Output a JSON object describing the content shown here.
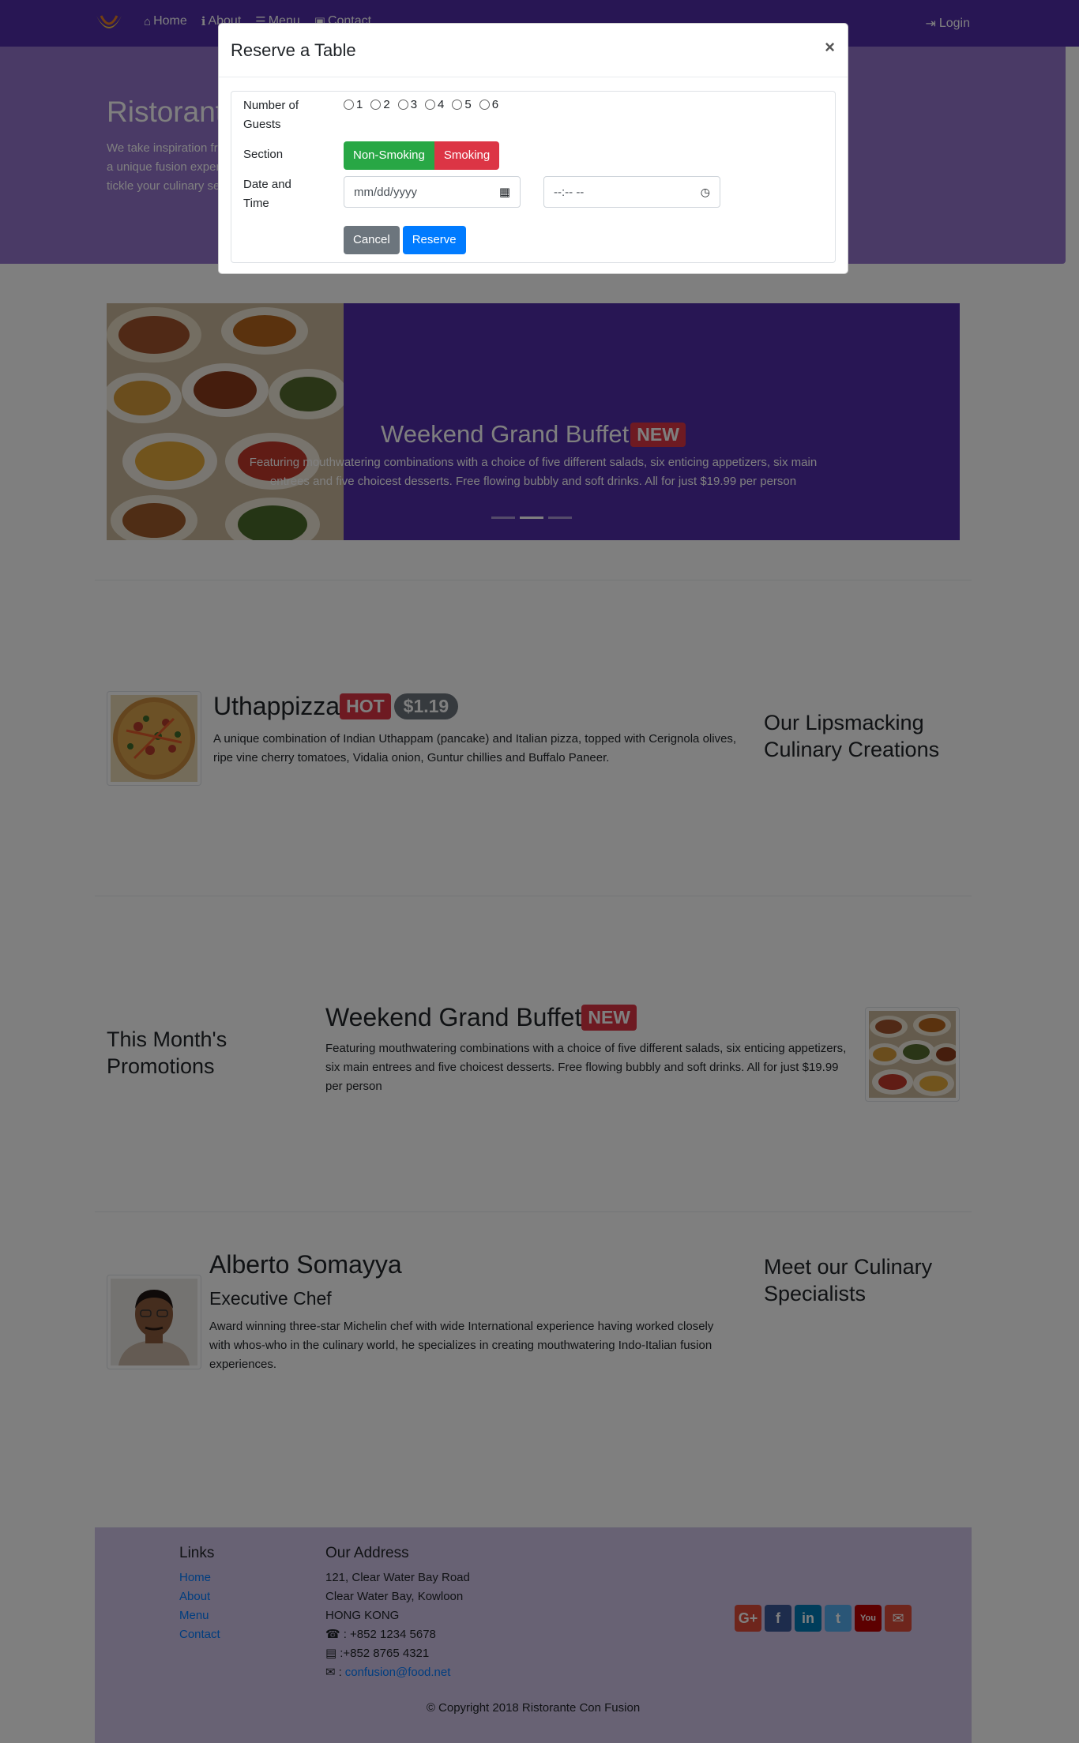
{
  "navbar": {
    "links": [
      {
        "label": "Home",
        "icon": "home-icon"
      },
      {
        "label": "About",
        "icon": "info-icon"
      },
      {
        "label": "Menu",
        "icon": "list-icon"
      },
      {
        "label": "Contact",
        "icon": "address-card-icon"
      }
    ],
    "login_label": "Login"
  },
  "jumbotron": {
    "title": "Ristorante Con Fusion",
    "text": "We take inspiration from the World's best cuisines, and create a unique fusion experience. Our lipsmacking creations will tickle your culinary senses!"
  },
  "carousel": {
    "title": "Weekend Grand Buffet",
    "badge": "NEW",
    "description": "Featuring mouthwatering combinations with a choice of five different salads, six enticing appetizers, six main entrees and five choicest desserts. Free flowing bubbly and soft drinks. All for just $19.99 per person",
    "indicator_count": 3,
    "active_index": 1
  },
  "dish": {
    "heading": "Our Lipsmacking Culinary Creations",
    "title": "Uthappizza",
    "badge": "HOT",
    "price": "$1.19",
    "description": "A unique combination of Indian Uthappam (pancake) and Italian pizza, topped with Cerignola olives, ripe vine cherry tomatoes, Vidalia onion, Guntur chillies and Buffalo Paneer."
  },
  "promotion": {
    "heading": "This Month's Promotions",
    "title": "Weekend Grand Buffet",
    "badge": "NEW",
    "description": "Featuring mouthwatering combinations with a choice of five different salads, six enticing appetizers, six main entrees and five choicest desserts. Free flowing bubbly and soft drinks. All for just $19.99 per person"
  },
  "leader": {
    "heading": "Meet our Culinary Specialists",
    "name": "Alberto Somayya",
    "role": "Executive Chef",
    "description": "Award winning three-star Michelin chef with wide International experience having worked closely with whos-who in the culinary world, he specializes in creating mouthwatering Indo-Italian fusion experiences."
  },
  "footer": {
    "links_heading": "Links",
    "links": [
      "Home",
      "About",
      "Menu",
      "Contact"
    ],
    "address_heading": "Our Address",
    "address_lines": [
      "121, Clear Water Bay Road",
      "Clear Water Bay, Kowloon",
      "HONG KONG"
    ],
    "phone": ": +852 1234 5678",
    "fax": ":+852 8765 4321",
    "email": "confusion@food.net",
    "copyright": "© Copyright 2018 Ristorante Con Fusion",
    "social": [
      {
        "icon": "google-plus-icon",
        "label": "G+",
        "color": "#dd4b39"
      },
      {
        "icon": "facebook-icon",
        "label": "f",
        "color": "#3b5998"
      },
      {
        "icon": "linkedin-icon",
        "label": "in",
        "color": "#007bb6"
      },
      {
        "icon": "twitter-icon",
        "label": "t",
        "color": "#55acee"
      },
      {
        "icon": "youtube-icon",
        "label": "You",
        "color": "#bb0000"
      },
      {
        "icon": "mail-icon",
        "label": "✉",
        "color": "#dd4b39"
      }
    ]
  },
  "modal": {
    "title": "Reserve a Table",
    "close_label": "×",
    "guests_label": "Number of Guests",
    "guest_options": [
      "1",
      "2",
      "3",
      "4",
      "5",
      "6"
    ],
    "section_label": "Section",
    "section_options": [
      "Non-Smoking",
      "Smoking"
    ],
    "datetime_label": "Date and Time",
    "date_placeholder": "mm/dd/yyyy",
    "time_placeholder": "--:-- --",
    "cancel_label": "Cancel",
    "reserve_label": "Reserve"
  }
}
